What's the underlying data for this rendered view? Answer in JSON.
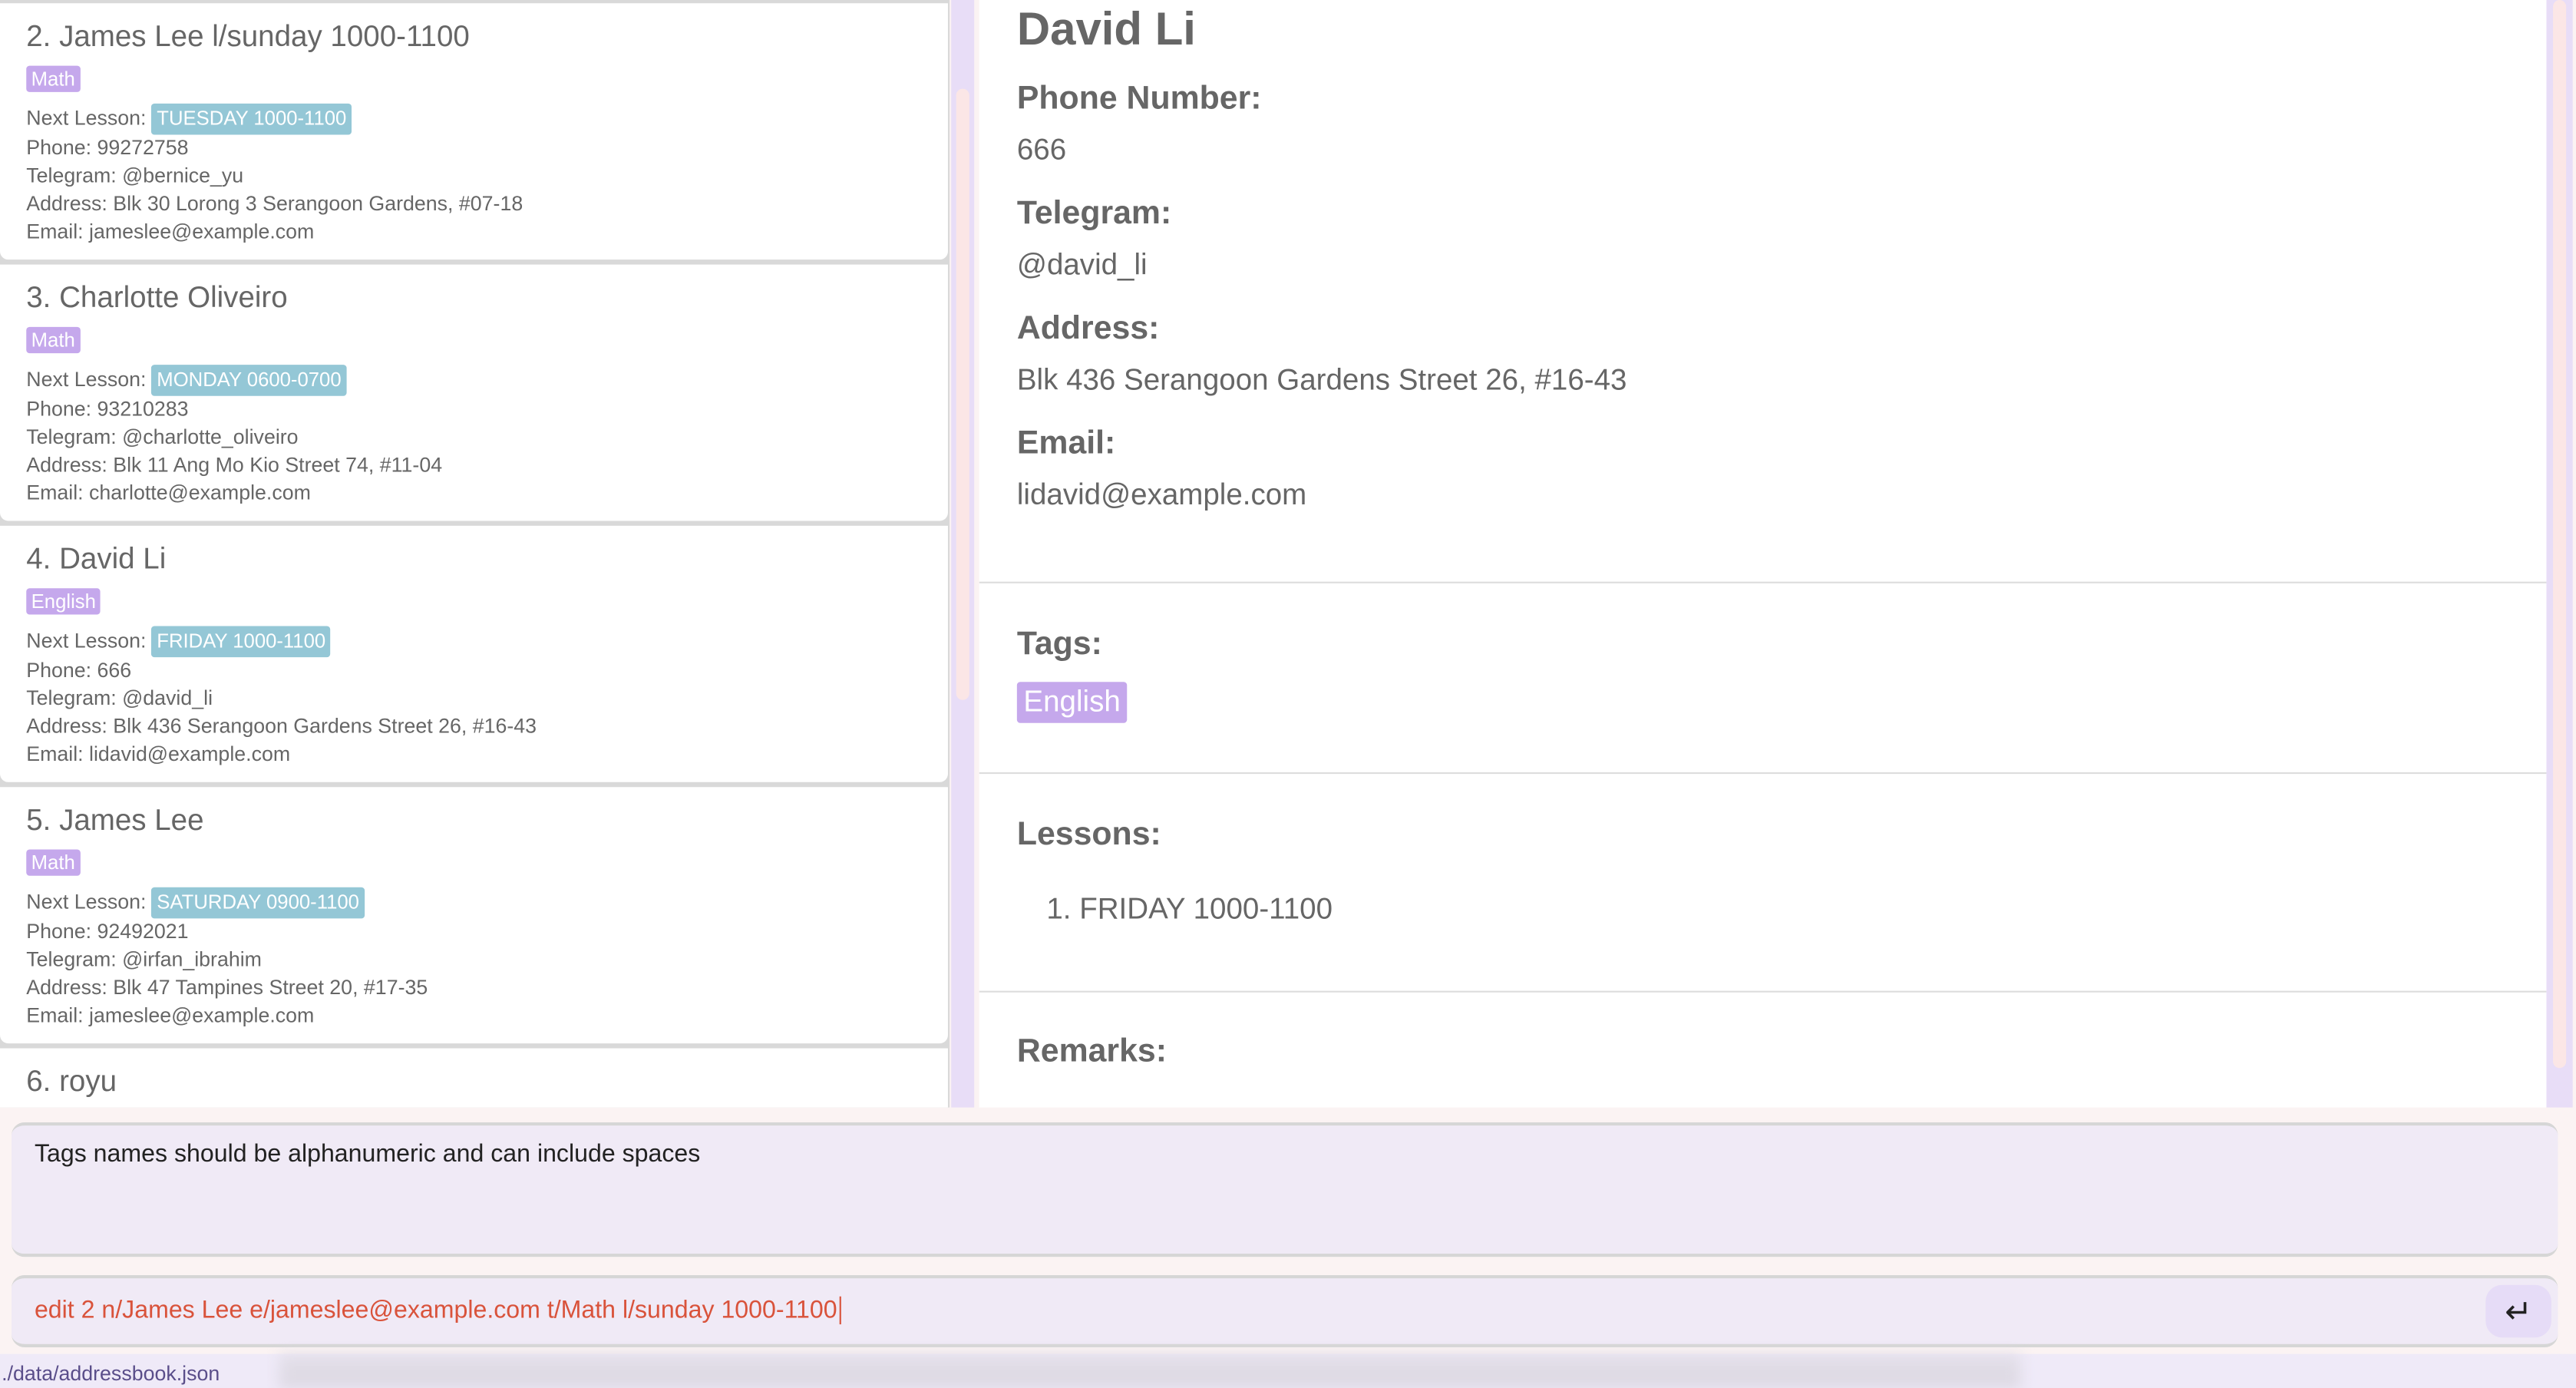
{
  "persons": [
    {
      "name": "2. James Lee l/sunday 1000-1100",
      "tag": "Math",
      "next_label": "Next Lesson:",
      "next": "TUESDAY 1000-1100",
      "phone": "Phone:  99272758",
      "telegram": "Telegram:  @bernice_yu",
      "address": "Address:  Blk 30 Lorong 3 Serangoon Gardens, #07-18",
      "email": "Email:  jameslee@example.com"
    },
    {
      "name": "3. Charlotte Oliveiro",
      "tag": "Math",
      "next_label": "Next Lesson:",
      "next": "MONDAY 0600-0700",
      "phone": "Phone:  93210283",
      "telegram": "Telegram:  @charlotte_oliveiro",
      "address": "Address:  Blk 11 Ang Mo Kio Street 74, #11-04",
      "email": "Email:  charlotte@example.com"
    },
    {
      "name": "4. David Li",
      "tag": "English",
      "next_label": "Next Lesson:",
      "next": "FRIDAY 1000-1100",
      "phone": "Phone:  666",
      "telegram": "Telegram:  @david_li",
      "address": "Address:  Blk 436 Serangoon Gardens Street 26, #16-43",
      "email": "Email:  lidavid@example.com"
    },
    {
      "name": "5. James Lee",
      "tag": "Math",
      "next_label": "Next Lesson:",
      "next": "SATURDAY 0900-1100",
      "phone": "Phone:  92492021",
      "telegram": "Telegram:  @irfan_ibrahim",
      "address": "Address:  Blk 47 Tampines Street 20, #17-35",
      "email": "Email:  jameslee@example.com"
    },
    {
      "name": "6. royu"
    }
  ],
  "detail": {
    "name": "David Li",
    "phone_label": "Phone Number:",
    "phone": "666",
    "telegram_label": "Telegram:",
    "telegram": "@david_li",
    "address_label": "Address:",
    "address": "Blk 436 Serangoon Gardens Street 26, #16-43",
    "email_label": "Email:",
    "email": "lidavid@example.com",
    "tags_label": "Tags:",
    "tags": [
      "English"
    ],
    "lessons_label": "Lessons:",
    "lessons": [
      "1. FRIDAY 1000-1100"
    ],
    "remarks_label": "Remarks:"
  },
  "result": "Tags names should be alphanumeric and can include spaces",
  "command": "edit 2 n/James Lee e/jameslee@example.com t/Math l/sunday 1000-1100",
  "enter_icon": "↵",
  "status": "./data/addressbook.json"
}
